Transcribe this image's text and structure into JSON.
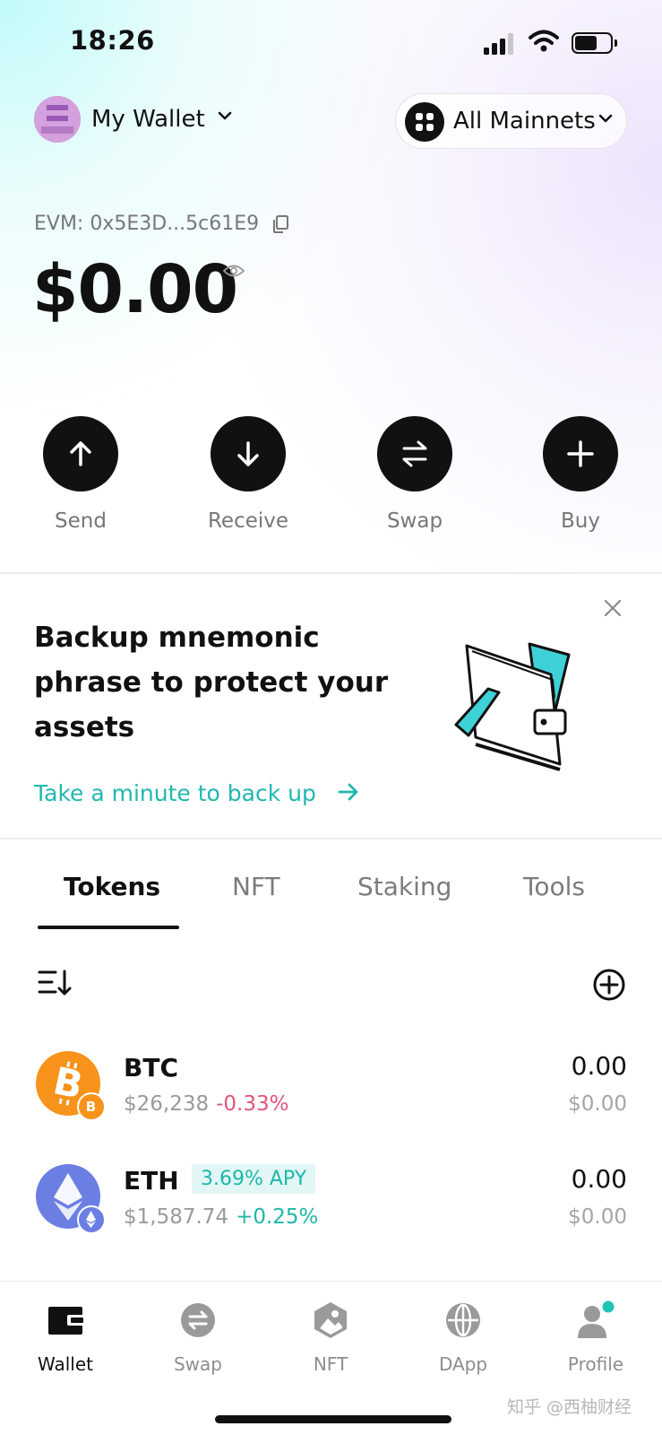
{
  "status_bar": {
    "time": "18:26"
  },
  "header": {
    "wallet_name": "My Wallet",
    "network_label": "All Mainnets"
  },
  "account": {
    "address": "EVM: 0x5E3D...5c61E9",
    "balance": "$0.00"
  },
  "actions": [
    {
      "label": "Send",
      "icon": "arrow-up-icon"
    },
    {
      "label": "Receive",
      "icon": "arrow-down-icon"
    },
    {
      "label": "Swap",
      "icon": "swap-icon"
    },
    {
      "label": "Buy",
      "icon": "plus-icon"
    }
  ],
  "backup_card": {
    "title": "Backup mnemonic phrase to protect your assets",
    "link": "Take a minute to back up"
  },
  "tabs": [
    {
      "label": "Tokens",
      "active": true
    },
    {
      "label": "NFT",
      "active": false
    },
    {
      "label": "Staking",
      "active": false
    },
    {
      "label": "Tools",
      "active": false
    }
  ],
  "tokens": [
    {
      "symbol": "BTC",
      "price": "$26,238",
      "change": "-0.33%",
      "amount": "0.00",
      "value": "$0.00",
      "change_color": "#e0557a",
      "logo_color": "#f7931a"
    },
    {
      "symbol": "ETH",
      "badge": "3.69% APY",
      "price": "$1,587.74",
      "change": "+0.25%",
      "amount": "0.00",
      "value": "$0.00",
      "change_color": "#1eb7a9",
      "logo_color": "#6b7fe3"
    }
  ],
  "bottom_nav": [
    {
      "label": "Wallet",
      "icon": "wallet-icon",
      "active": true
    },
    {
      "label": "Swap",
      "icon": "swap-icon",
      "active": false
    },
    {
      "label": "NFT",
      "icon": "nft-icon",
      "active": false
    },
    {
      "label": "DApp",
      "icon": "globe-icon",
      "active": false
    },
    {
      "label": "Profile",
      "icon": "profile-icon",
      "active": false
    }
  ],
  "watermark": "知乎 @西柚财经",
  "colors": {
    "accent": "#20b8b0",
    "negative": "#e0557a",
    "positive": "#1eb7a9",
    "primary": "#111111"
  }
}
